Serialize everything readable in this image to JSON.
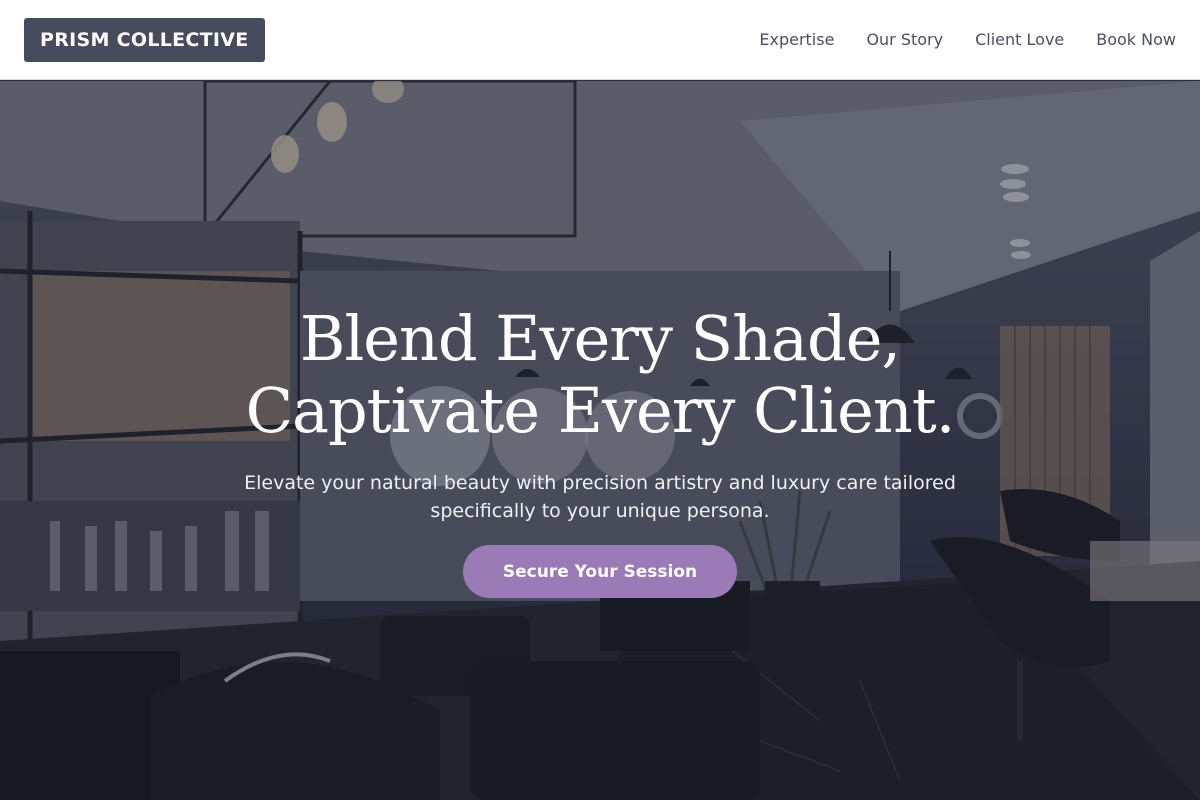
{
  "header": {
    "logo_text": "PRISM COLLECTIVE",
    "nav": [
      {
        "label": "Expertise"
      },
      {
        "label": "Our Story"
      },
      {
        "label": "Client Love"
      },
      {
        "label": "Book Now"
      }
    ]
  },
  "hero": {
    "headline_line1": "Blend Every Shade,",
    "headline_line2": "Captivate Every Client.",
    "subtext": "Elevate your natural beauty with precision artistry and luxury care tailored specifically to your unique persona.",
    "cta_label": "Secure Your Session"
  },
  "colors": {
    "logo_bg": "#454b5c",
    "cta_bg": "#9a7ab7",
    "nav_text": "#4a5063"
  }
}
